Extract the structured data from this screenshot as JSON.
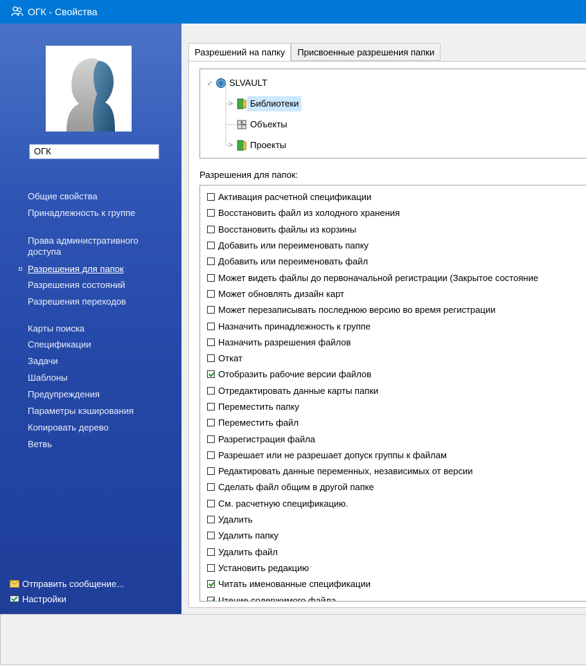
{
  "window": {
    "title": "ОГК - Свойства"
  },
  "sidebar": {
    "name": "ОГК",
    "nav_groups": [
      [
        {
          "label": "Общие свойства"
        },
        {
          "label": "Принадлежность к группе"
        }
      ],
      [
        {
          "label": "Права административного доступа"
        },
        {
          "label": "Разрешения для папок",
          "active": true
        },
        {
          "label": "Разрешения состояний"
        },
        {
          "label": "Разрешения переходов"
        }
      ],
      [
        {
          "label": "Карты поиска"
        },
        {
          "label": "Спецификации"
        },
        {
          "label": "Задачи"
        },
        {
          "label": "Шаблоны"
        },
        {
          "label": "Предупреждения"
        },
        {
          "label": "Параметры кэширования"
        },
        {
          "label": "Копировать дерево"
        },
        {
          "label": "Ветвь"
        }
      ]
    ],
    "footer": {
      "send_message": "Отправить сообщение...",
      "settings": "Настройки"
    }
  },
  "tabs": [
    {
      "label": "Разрешений на папку",
      "active": true
    },
    {
      "label": "Присвоенные разрешения папки"
    }
  ],
  "tree": {
    "root": "SLVAULT",
    "children": [
      {
        "label": "Библиотеки",
        "expandable": true,
        "selected": true,
        "icon": "green-book-icon"
      },
      {
        "label": "Объекты",
        "expandable": false,
        "icon": "puzzle-icon"
      },
      {
        "label": "Проекты",
        "expandable": true,
        "icon": "green-book-icon"
      }
    ]
  },
  "permissions": {
    "title": "Разрешения для папок:",
    "items": [
      {
        "label": "Активация расчетной спецификации",
        "checked": false
      },
      {
        "label": "Восстановить файл из холодного хранения",
        "checked": false
      },
      {
        "label": "Восстановить файлы из корзины",
        "checked": false
      },
      {
        "label": "Добавить или переименовать папку",
        "checked": false
      },
      {
        "label": "Добавить или переименовать файл",
        "checked": false
      },
      {
        "label": "Может видеть файлы до первоначальной регистрации (Закрытое состояние",
        "checked": false
      },
      {
        "label": "Может обновлять дизайн карт",
        "checked": false
      },
      {
        "label": "Может перезаписывать последнюю версию во время регистрации",
        "checked": false
      },
      {
        "label": "Назначить принадлежность к группе",
        "checked": false
      },
      {
        "label": "Назначить разрешения файлов",
        "checked": false
      },
      {
        "label": "Откат",
        "checked": false
      },
      {
        "label": "Отобразить рабочие версии файлов",
        "checked": true
      },
      {
        "label": "Отредактировать данные карты папки",
        "checked": false
      },
      {
        "label": "Переместить папку",
        "checked": false
      },
      {
        "label": "Переместить файл",
        "checked": false
      },
      {
        "label": "Разрегистрация файла",
        "checked": false
      },
      {
        "label": "Разрешает или не разрешает допуск группы к файлам",
        "checked": false
      },
      {
        "label": "Редактировать данные переменных, независимых от версии",
        "checked": false
      },
      {
        "label": "Сделать файл общим в другой папке",
        "checked": false
      },
      {
        "label": "См. расчетную спецификацию.",
        "checked": false
      },
      {
        "label": "Удалить",
        "checked": false
      },
      {
        "label": "Удалить папку",
        "checked": false
      },
      {
        "label": "Удалить файл",
        "checked": false
      },
      {
        "label": "Установить редакцию",
        "checked": false
      },
      {
        "label": "Читать именованные спецификации",
        "checked": true
      },
      {
        "label": "Чтение содержимого файла",
        "checked": true
      }
    ]
  },
  "colors": {
    "titlebar": "#0078d7",
    "sidebar": "#2e54b4",
    "selection": "#cce8ff",
    "check": "#1a9a1a"
  }
}
